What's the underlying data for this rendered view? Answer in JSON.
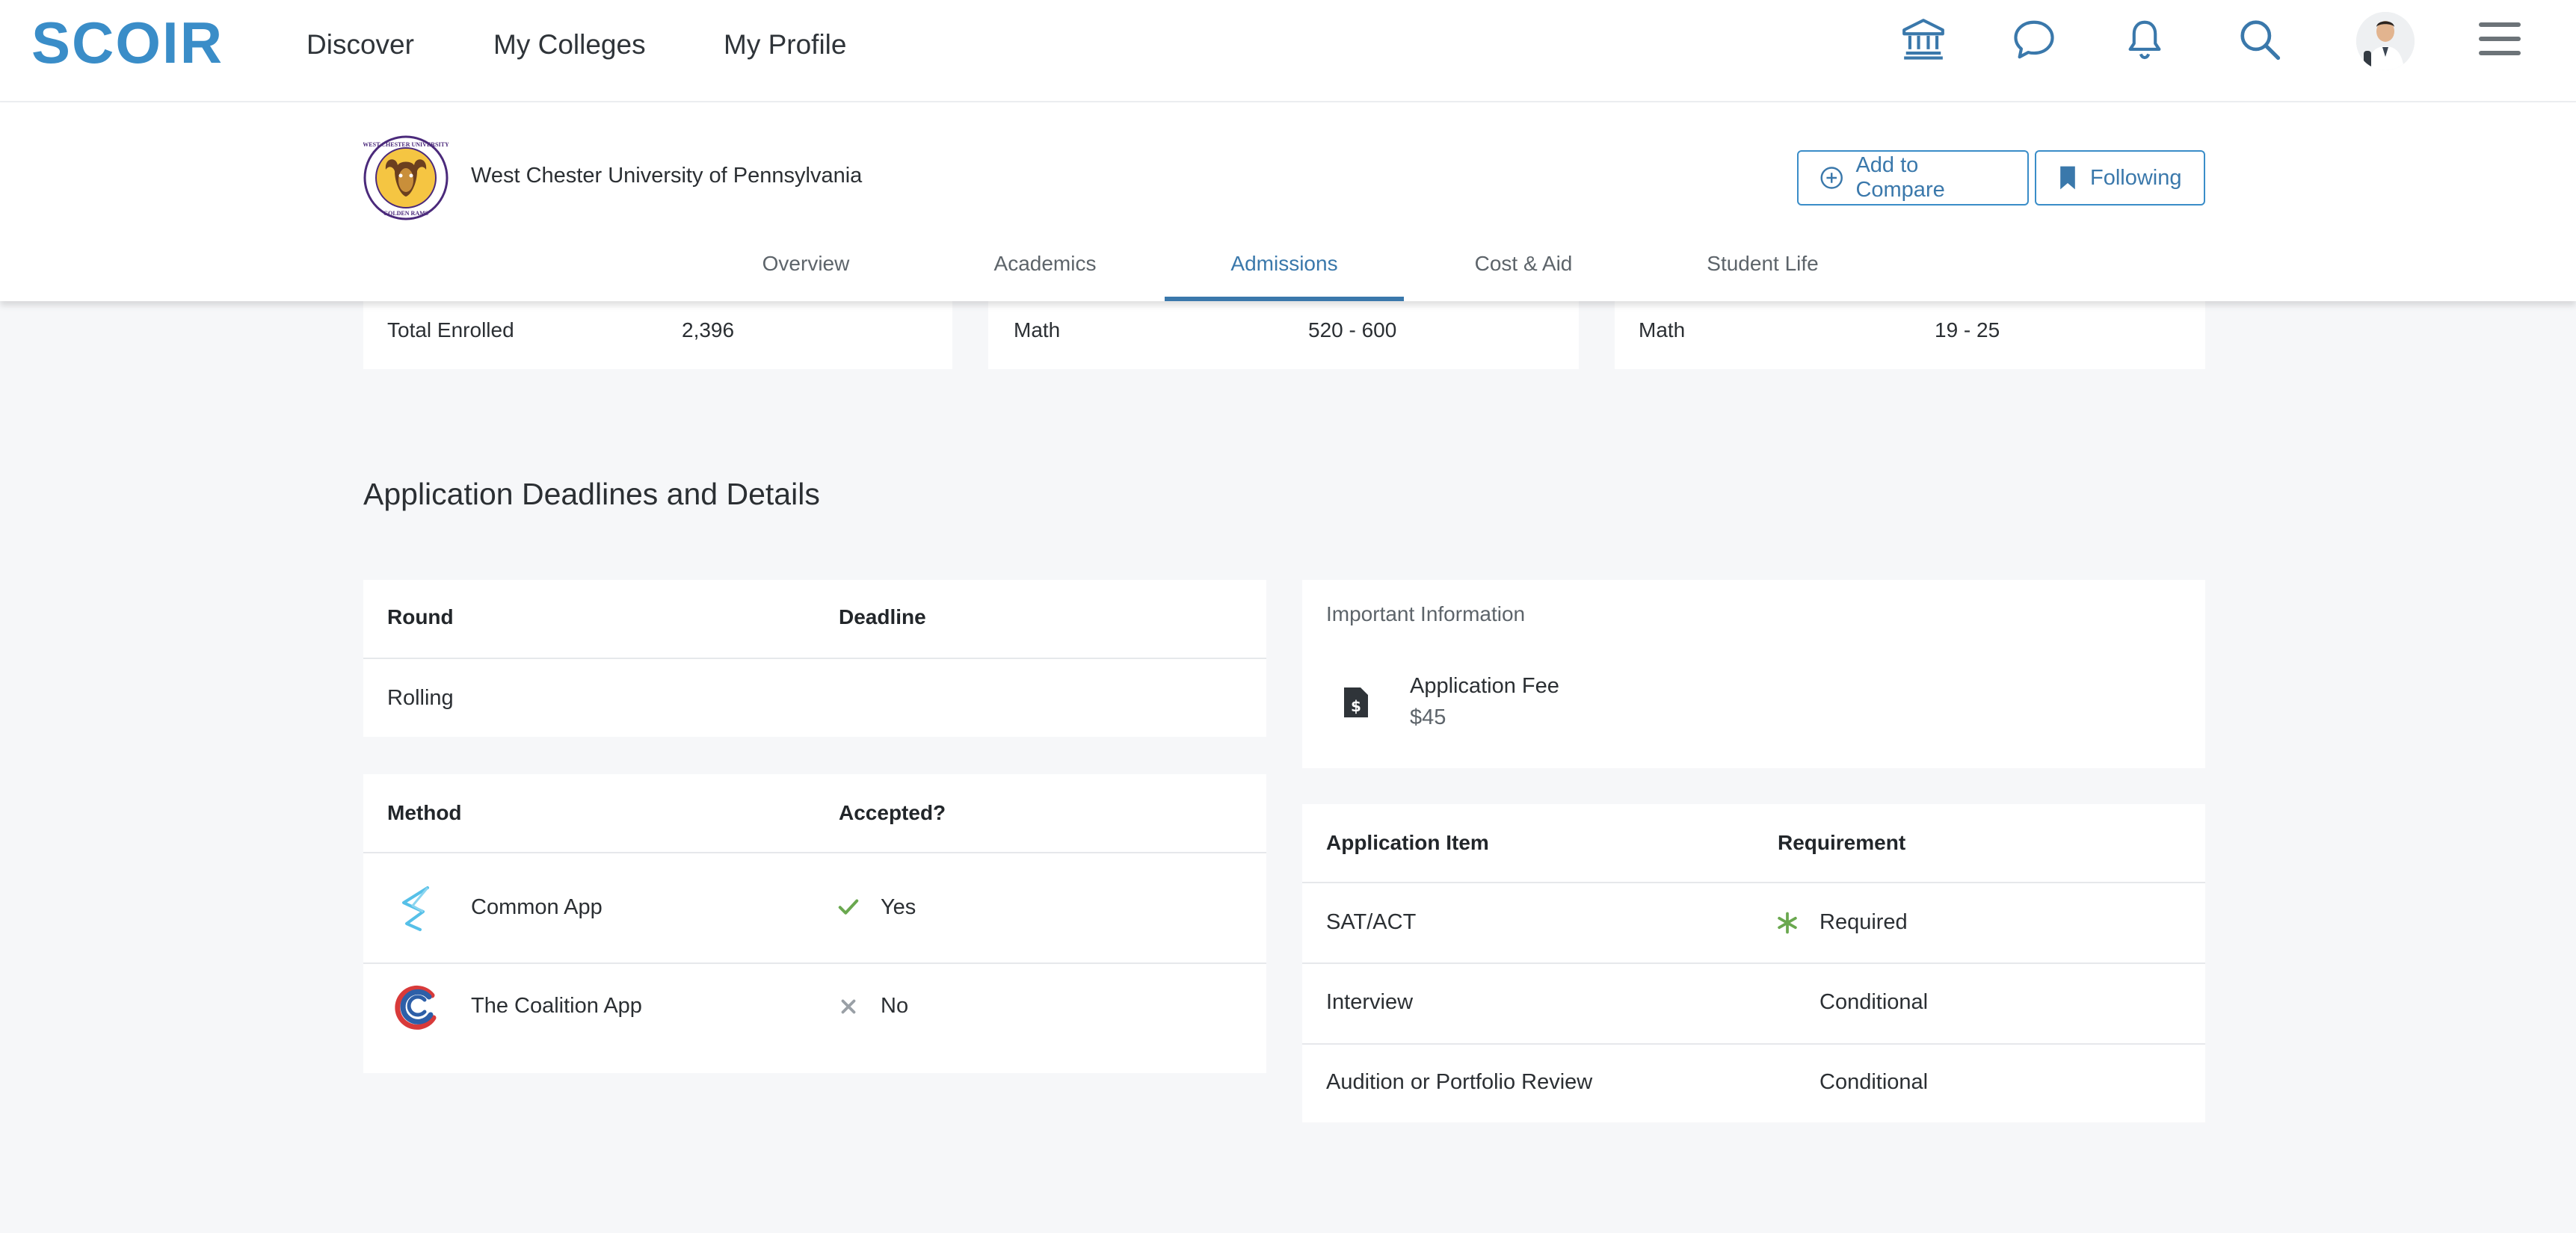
{
  "nav": {
    "logo": "SCOIR",
    "links": [
      "Discover",
      "My Colleges",
      "My Profile"
    ]
  },
  "college": {
    "name": "West Chester University of Pennsylvania",
    "seal_text_top": "WEST CHESTER UNIVERSITY",
    "seal_text_bottom": "GOLDEN RAMS",
    "add_compare_label": "Add to Compare",
    "following_label": "Following",
    "tabs": [
      "Overview",
      "Academics",
      "Admissions",
      "Cost & Aid",
      "Student Life"
    ],
    "active_tab": "Admissions"
  },
  "stats": {
    "enrolled": {
      "label": "Total Enrolled",
      "value": "2,396"
    },
    "sat_math": {
      "label": "Math",
      "value": "520 - 600"
    },
    "act_math": {
      "label": "Math",
      "value": "19 - 25"
    }
  },
  "deadlines": {
    "section_title": "Application Deadlines and Details",
    "round_header": "Round",
    "deadline_header": "Deadline",
    "rows": [
      {
        "round": "Rolling",
        "deadline": ""
      }
    ]
  },
  "methods": {
    "method_header": "Method",
    "accepted_header": "Accepted?",
    "rows": [
      {
        "name": "Common App",
        "accepted": "Yes",
        "accepted_icon": "check-icon"
      },
      {
        "name": "The Coalition App",
        "accepted": "No",
        "accepted_icon": "x-icon"
      }
    ]
  },
  "important_info": {
    "title": "Important Information",
    "fee_label": "Application Fee",
    "fee_value": "$45",
    "icon": "fee-document-icon"
  },
  "requirements": {
    "item_header": "Application Item",
    "requirement_header": "Requirement",
    "rows": [
      {
        "item": "SAT/ACT",
        "requirement": "Required",
        "required": true
      },
      {
        "item": "Interview",
        "requirement": "Conditional",
        "required": false
      },
      {
        "item": "Audition or Portfolio Review",
        "requirement": "Conditional",
        "required": false
      }
    ]
  },
  "colors": {
    "accent": "#3a78ab",
    "logo": "#3a8dc8",
    "check": "#6aa84f",
    "required_star": "#6aa84f"
  }
}
